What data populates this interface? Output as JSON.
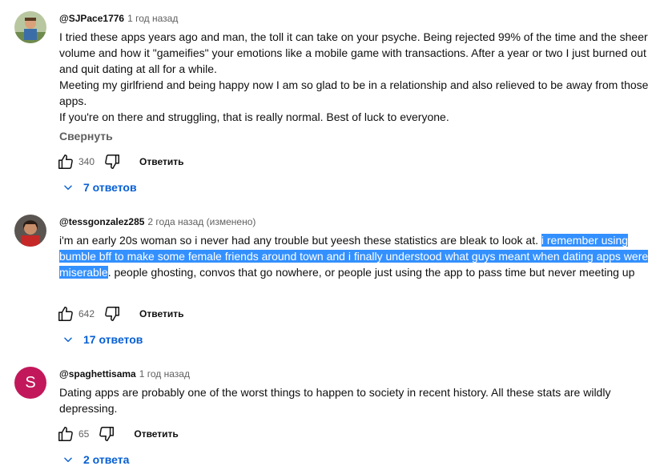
{
  "comments": [
    {
      "author": "@SJPace1776",
      "time": "1 год назад",
      "paragraphs": [
        "I tried these apps years ago and man, the toll it can take on your psyche.  Being rejected 99% of the time and the sheer volume and how it \"gameifies\" your emotions like a mobile game with transactions. After a year or two I just burned out and quit dating at all for a while.",
        "Meeting my girlfriend and being happy now I am so glad to be in a relationship and also relieved to be away from those apps.",
        "If you're on there and struggling, that is really normal. Best of luck to everyone."
      ],
      "collapse_label": "Свернуть",
      "likes": "340",
      "reply_label": "Ответить",
      "replies_label": "7 ответов"
    },
    {
      "author": "@tessgonzalez285",
      "time": "2 года назад (изменено)",
      "text_before": "i'm an early 20s woman so i never had any trouble but yeesh these statistics are bleak to look at. ",
      "text_selected": "i remember using bumble bff to make some female friends around town and i finally understood what guys meant when dating apps were miserable",
      "text_after": ". people ghosting, convos that go nowhere, or people just using the app to pass time but never meeting up",
      "likes": "642",
      "reply_label": "Ответить",
      "replies_label": "17 ответов"
    },
    {
      "author": "@spaghettisama",
      "time": "1 год назад",
      "avatar_letter": "S",
      "avatar_color": "#c2185b",
      "text": "Dating apps are probably one of the worst things to happen to society in recent history. All these stats are wildly depressing.",
      "likes": "65",
      "reply_label": "Ответить",
      "replies_label": "2 ответа"
    }
  ],
  "colors": {
    "selection": "#3390ff",
    "link_blue": "#065fd4",
    "meta_gray": "#606060"
  },
  "icons": [
    "thumbs-up-icon",
    "thumbs-down-icon",
    "chevron-down-icon"
  ]
}
